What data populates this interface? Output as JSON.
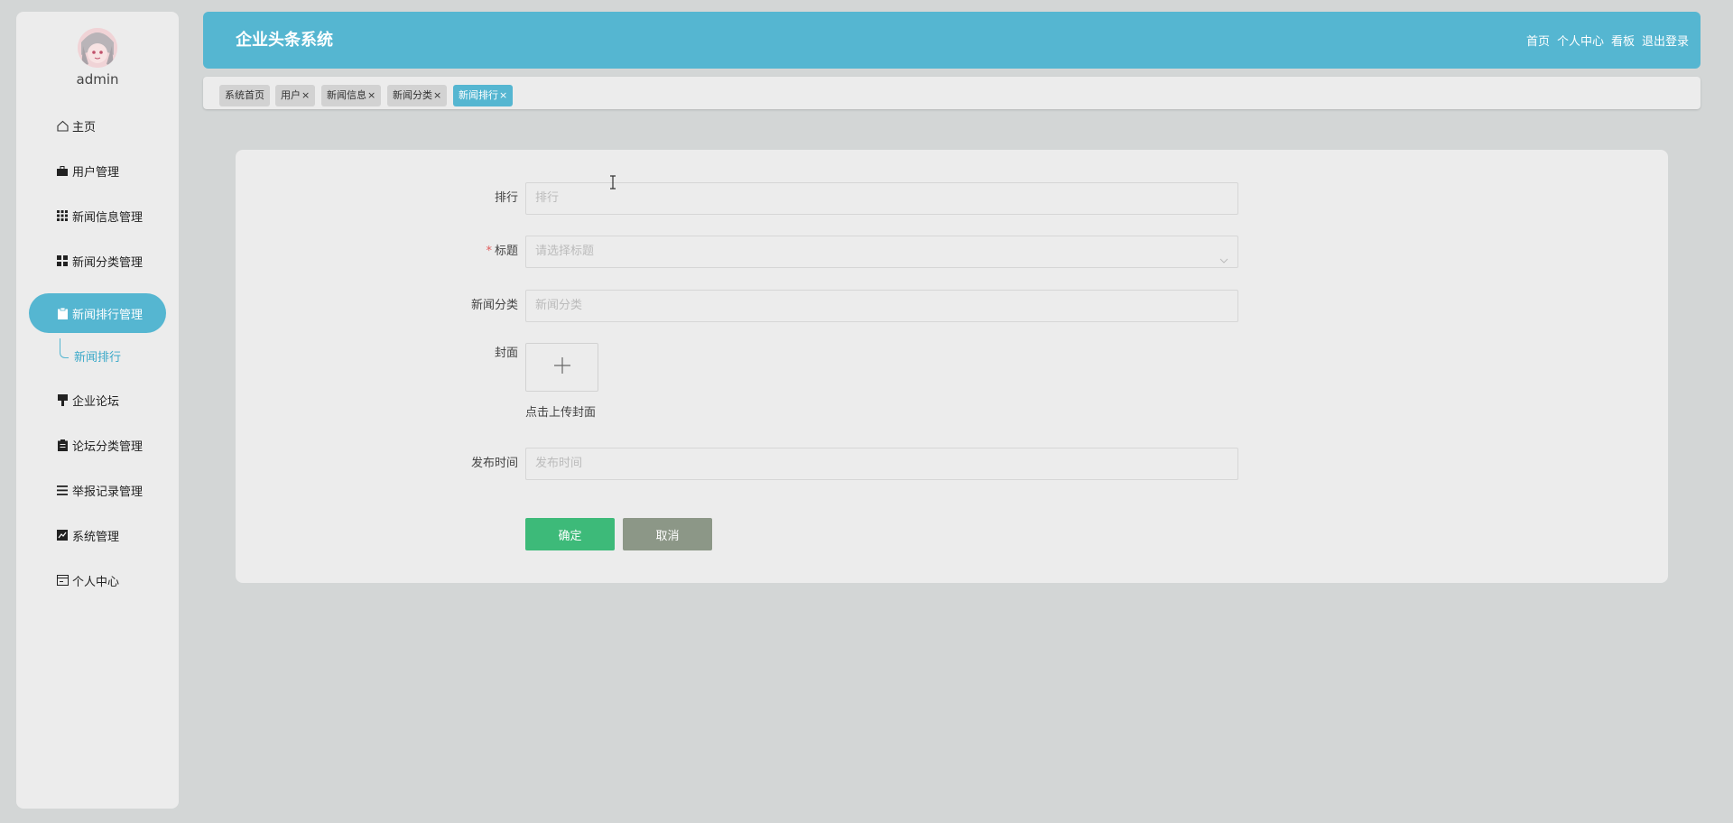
{
  "user": {
    "name": "admin"
  },
  "sidebar": {
    "items": [
      {
        "label": "主页",
        "icon": "home-icon"
      },
      {
        "label": "用户管理",
        "icon": "briefcase-icon"
      },
      {
        "label": "新闻信息管理",
        "icon": "grid-icon"
      },
      {
        "label": "新闻分类管理",
        "icon": "apps-icon"
      },
      {
        "label": "新闻排行管理",
        "icon": "clipboard-icon",
        "active": true
      },
      {
        "label": "企业论坛",
        "icon": "flag-icon"
      },
      {
        "label": "论坛分类管理",
        "icon": "clipboard-icon"
      },
      {
        "label": "举报记录管理",
        "icon": "list-icon"
      },
      {
        "label": "系统管理",
        "icon": "chart-icon"
      },
      {
        "label": "个人中心",
        "icon": "card-icon"
      }
    ],
    "submenu": {
      "label": "新闻排行"
    }
  },
  "header": {
    "title": "企业头条系统",
    "links": [
      "首页",
      "个人中心",
      "看板",
      "退出登录"
    ]
  },
  "tabs": [
    {
      "label": "系统首页",
      "closable": false
    },
    {
      "label": "用户",
      "closable": true
    },
    {
      "label": "新闻信息",
      "closable": true
    },
    {
      "label": "新闻分类",
      "closable": true
    },
    {
      "label": "新闻排行",
      "closable": true,
      "active": true
    }
  ],
  "tab_close_glyph": "×",
  "form": {
    "rank": {
      "label": "排行",
      "placeholder": "排行"
    },
    "title": {
      "label": "标题",
      "required_mark": "*",
      "placeholder": "请选择标题"
    },
    "category": {
      "label": "新闻分类",
      "placeholder": "新闻分类"
    },
    "cover": {
      "label": "封面",
      "hint": "点击上传封面"
    },
    "publish_time": {
      "label": "发布时间",
      "placeholder": "发布时间"
    },
    "confirm_label": "确定",
    "cancel_label": "取消"
  },
  "colors": {
    "accent": "#55b6d1",
    "confirm": "#3dba79",
    "cancel": "#8c9787",
    "required": "#e05d5d"
  }
}
